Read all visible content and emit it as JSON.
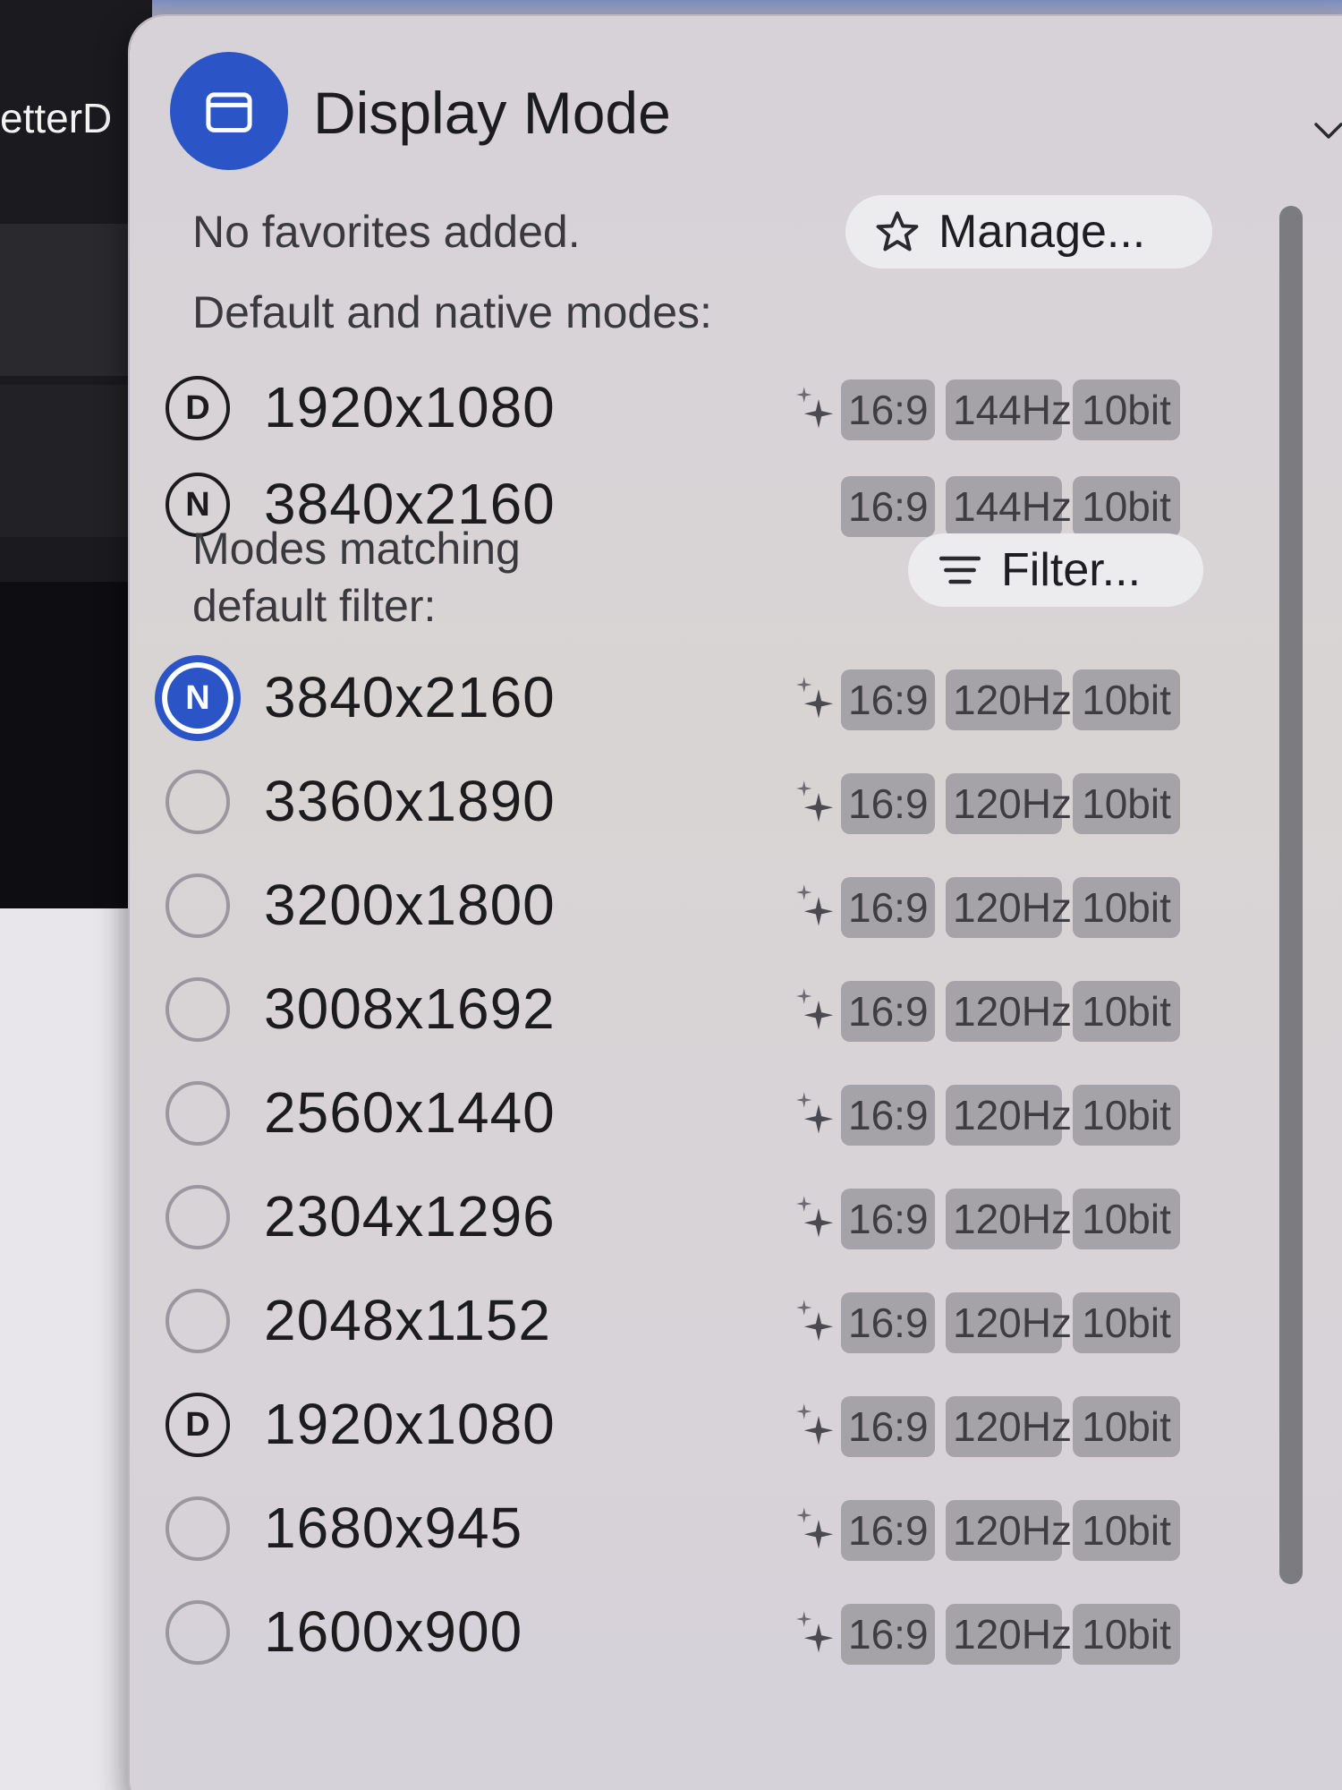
{
  "background_app": {
    "title_fragment": "etterD"
  },
  "header": {
    "title": "Display Mode",
    "icon": "display-window-icon",
    "chevron": "chevron-down-icon",
    "accent_color": "#2b55c7"
  },
  "favorites": {
    "message": "No favorites added.",
    "manage_label": "Manage...",
    "manage_icon": "star-icon"
  },
  "default_native": {
    "heading": "Default and native modes:",
    "modes": [
      {
        "badge": "D",
        "resolution": "1920x1080",
        "sparkle": true,
        "aspect": "16:9",
        "rate": "144Hz",
        "depth": "10bit"
      },
      {
        "badge": "N",
        "resolution": "3840x2160",
        "sparkle": false,
        "aspect": "16:9",
        "rate": "144Hz",
        "depth": "10bit"
      }
    ]
  },
  "filtered": {
    "heading_line1": "Modes matching",
    "heading_line2": "default filter:",
    "filter_label": "Filter...",
    "filter_icon": "filter-lines-icon",
    "modes": [
      {
        "badge": "N",
        "selected": true,
        "resolution": "3840x2160",
        "aspect": "16:9",
        "rate": "120Hz",
        "depth": "10bit"
      },
      {
        "badge": "",
        "selected": false,
        "resolution": "3360x1890",
        "aspect": "16:9",
        "rate": "120Hz",
        "depth": "10bit"
      },
      {
        "badge": "",
        "selected": false,
        "resolution": "3200x1800",
        "aspect": "16:9",
        "rate": "120Hz",
        "depth": "10bit"
      },
      {
        "badge": "",
        "selected": false,
        "resolution": "3008x1692",
        "aspect": "16:9",
        "rate": "120Hz",
        "depth": "10bit"
      },
      {
        "badge": "",
        "selected": false,
        "resolution": "2560x1440",
        "aspect": "16:9",
        "rate": "120Hz",
        "depth": "10bit"
      },
      {
        "badge": "",
        "selected": false,
        "resolution": "2304x1296",
        "aspect": "16:9",
        "rate": "120Hz",
        "depth": "10bit"
      },
      {
        "badge": "",
        "selected": false,
        "resolution": "2048x1152",
        "aspect": "16:9",
        "rate": "120Hz",
        "depth": "10bit"
      },
      {
        "badge": "D",
        "selected": false,
        "resolution": "1920x1080",
        "aspect": "16:9",
        "rate": "120Hz",
        "depth": "10bit"
      },
      {
        "badge": "",
        "selected": false,
        "resolution": "1680x945",
        "aspect": "16:9",
        "rate": "120Hz",
        "depth": "10bit"
      },
      {
        "badge": "",
        "selected": false,
        "resolution": "1600x900",
        "aspect": "16:9",
        "rate": "120Hz",
        "depth": "10bit"
      }
    ]
  }
}
